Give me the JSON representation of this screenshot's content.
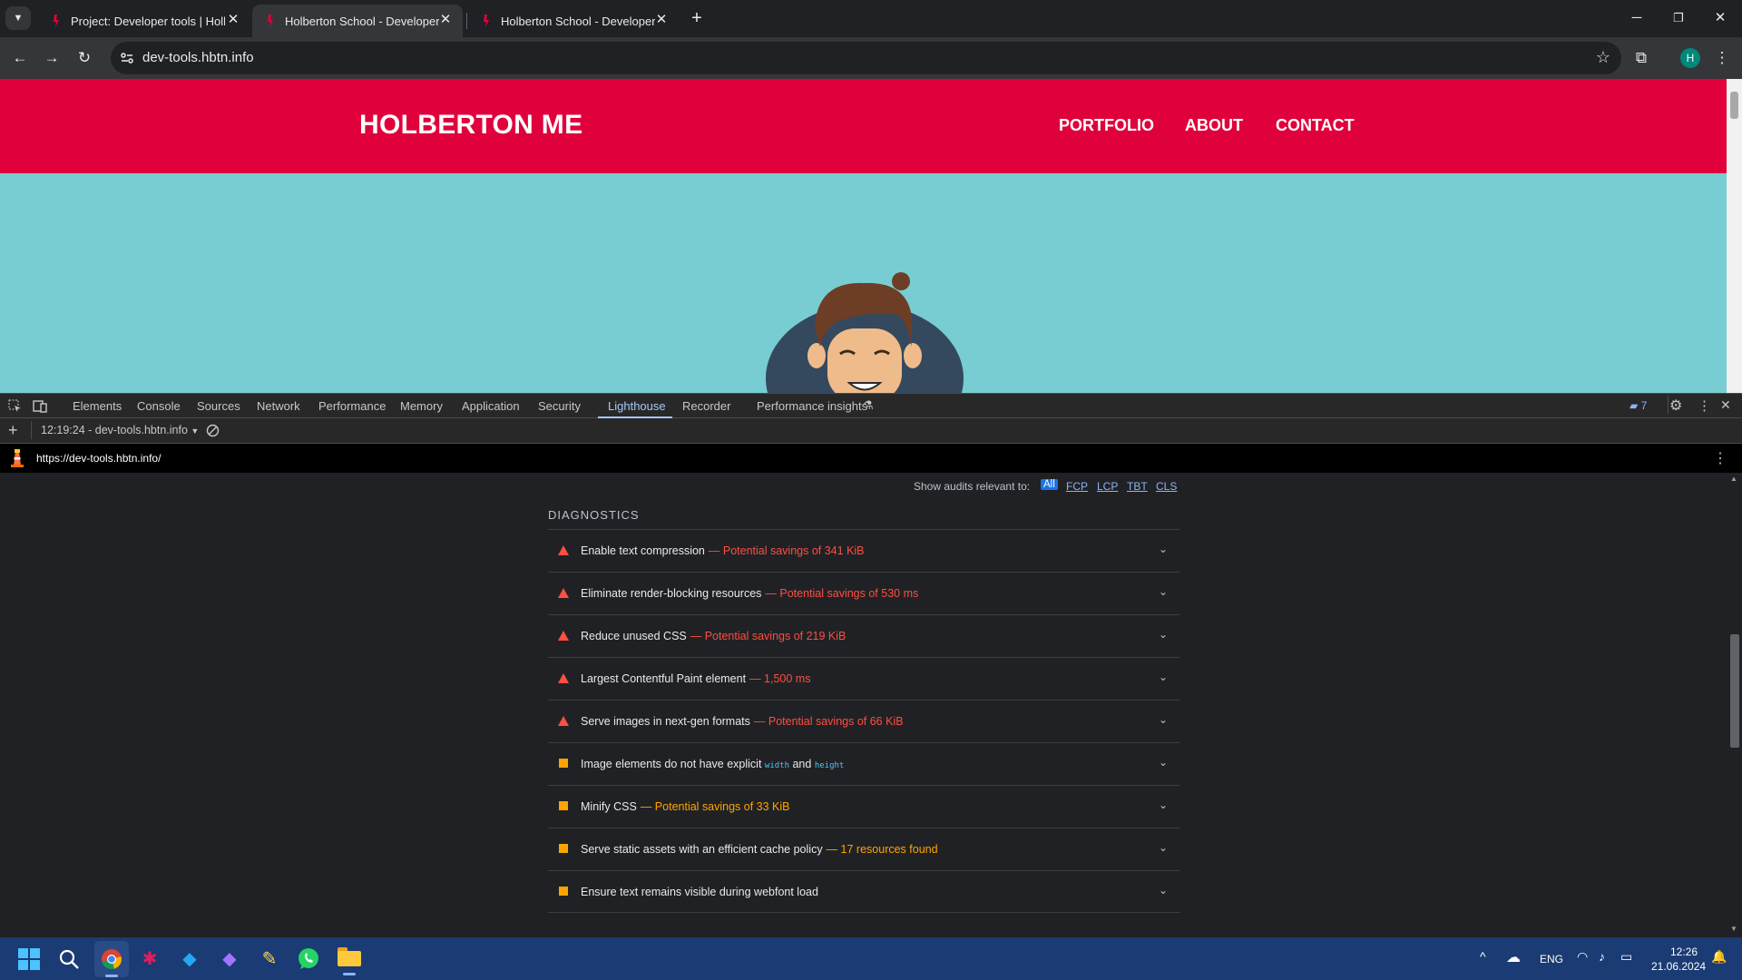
{
  "browser": {
    "tabs": [
      {
        "title": "Project: Developer tools | Holbe",
        "active": false
      },
      {
        "title": "Holberton School - Developer t",
        "active": true
      },
      {
        "title": "Holberton School - Developer t",
        "active": false
      }
    ],
    "url": "dev-tools.hbtn.info",
    "profile_initial": "H"
  },
  "site": {
    "title": "HOLBERTON ME",
    "nav": [
      "PORTFOLIO",
      "ABOUT",
      "CONTACT"
    ]
  },
  "devtools": {
    "tabs": [
      "Elements",
      "Console",
      "Sources",
      "Network",
      "Performance",
      "Memory",
      "Application",
      "Security",
      "Lighthouse",
      "Recorder",
      "Performance insights"
    ],
    "active_tab": "Lighthouse",
    "issues_count": "7",
    "report_select": "12:19:24 - dev-tools.hbtn.info",
    "report_url": "https://dev-tools.hbtn.info/",
    "filter_label": "Show audits relevant to:",
    "filters": [
      "All",
      "FCP",
      "LCP",
      "TBT",
      "CLS"
    ],
    "section_title": "DIAGNOSTICS",
    "audits": [
      {
        "title": "Enable text compression",
        "savings": "— Potential savings of 341 KiB",
        "status": "fail"
      },
      {
        "title": "Eliminate render-blocking resources",
        "savings": "— Potential savings of 530 ms",
        "status": "fail"
      },
      {
        "title": "Reduce unused CSS",
        "savings": "— Potential savings of 219 KiB",
        "status": "fail"
      },
      {
        "title": "Largest Contentful Paint element",
        "savings": "— 1,500 ms",
        "status": "fail"
      },
      {
        "title": "Serve images in next-gen formats",
        "savings": "— Potential savings of 66 KiB",
        "status": "fail"
      },
      {
        "title": "Image elements do not have explicit",
        "code1": "width",
        "and": "and",
        "code2": "height",
        "status": "average"
      },
      {
        "title": "Minify CSS",
        "savings": "— Potential savings of 33 KiB",
        "status": "average"
      },
      {
        "title": "Serve static assets with an efficient cache policy",
        "savings": "— 17 resources found",
        "status": "average"
      },
      {
        "title": "Ensure text remains visible during webfont load",
        "savings": "",
        "status": "average"
      }
    ]
  },
  "taskbar": {
    "language": "ENG",
    "time": "12:26",
    "date": "21.06.2024"
  },
  "colors": {
    "brand_red": "#e0003c",
    "hero_teal": "#77cdd2",
    "fail_red": "#ff4e42",
    "average_orange": "#ffa400"
  }
}
